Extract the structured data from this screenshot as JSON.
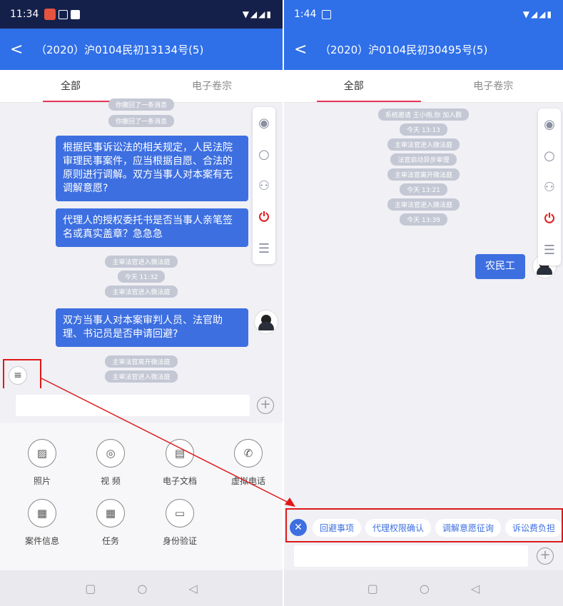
{
  "left": {
    "status": {
      "time": "11:34"
    },
    "header": {
      "back": "<",
      "title": "（2020）沪0104民初13134号(5)"
    },
    "tabs": [
      "全部",
      "电子卷宗"
    ],
    "messages": {
      "sys_top_cut": "你撤回了一条消息",
      "sys_recall": "你撤回了一条消息",
      "bubble1": "根据民事诉讼法的相关规定，人民法院审理民事案件，应当根据自愿、合法的原则进行调解。双方当事人对本案有无调解意愿?",
      "bubble2": "代理人的授权委托书是否当事人亲笔签名或真实盖章？急急急",
      "sys_enter1": "主审法官进入微法庭",
      "sys_time": "今天 11:32",
      "sys_enter2": "主审法官进入微法庭",
      "bubble3": "双方当事人对本案审判人员、法官助理、书记员是否申请回避?",
      "sys_leave": "主审法官离开微法庭",
      "sys_enter3": "主审法官进入微法庭"
    },
    "tools": [
      {
        "icon": "photo-icon",
        "label": "照片"
      },
      {
        "icon": "camera-icon",
        "label": "视 频"
      },
      {
        "icon": "document-icon",
        "label": "电子文档"
      },
      {
        "icon": "phone-icon",
        "label": "虚拟电话"
      },
      {
        "icon": "case-info-icon",
        "label": "案件信息"
      },
      {
        "icon": "task-icon",
        "label": "任务"
      },
      {
        "icon": "id-verify-icon",
        "label": "身份验证"
      }
    ]
  },
  "right": {
    "status": {
      "time": "1:44"
    },
    "header": {
      "back": "<",
      "title": "（2020）沪0104民初30495号(5)"
    },
    "tabs": [
      "全部",
      "电子卷宗"
    ],
    "messages": {
      "sys_invite": "系统邀请 王小雨,你 加入群",
      "sys_time1": "今天 13:13",
      "sys_enter1": "主审法官进入微法庭",
      "sys_start": "法官启动异步审理",
      "sys_leave": "主审法官离开微法庭",
      "sys_time2": "今天 13:21",
      "sys_enter2": "主审法官进入微法庭",
      "sys_time3": "今天 13:39",
      "bubble1": "农民工"
    },
    "quick_actions": [
      "回避事项",
      "代理权限确认",
      "调解意愿征询",
      "诉讼费负担"
    ]
  },
  "colors": {
    "accent": "#3d6fe0",
    "header": "#2f6fe8",
    "annotation": "#e01818",
    "tab_underline": "#e8365a"
  }
}
